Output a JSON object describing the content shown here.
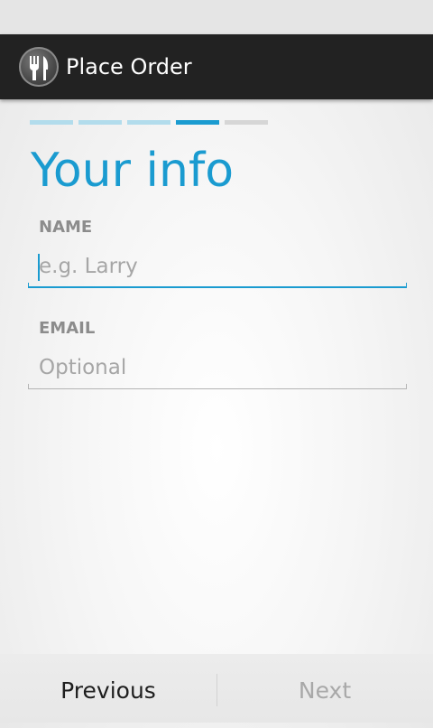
{
  "action_bar": {
    "title": "Place Order",
    "icon": "fork-knife-icon"
  },
  "progress": {
    "total_steps": 5,
    "current_step": 4,
    "colors": {
      "completed": "#b2dcec",
      "current": "#1a9bd0",
      "pending": "#d6d6d6"
    }
  },
  "page": {
    "title": "Your info"
  },
  "form": {
    "name": {
      "label": "NAME",
      "placeholder": "e.g. Larry",
      "value": ""
    },
    "email": {
      "label": "EMAIL",
      "placeholder": "Optional",
      "value": ""
    }
  },
  "footer": {
    "previous_label": "Previous",
    "next_label": "Next",
    "next_enabled": false
  },
  "colors": {
    "accent": "#1a9bd0",
    "focused_underline": "#1a9bd0",
    "inactive_underline": "#b4b4b4",
    "disabled_text": "#a8a8a8",
    "enabled_text": "#1e1e1e"
  }
}
